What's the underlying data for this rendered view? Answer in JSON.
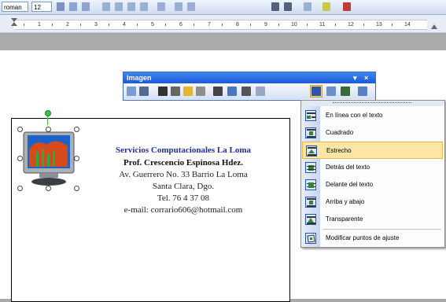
{
  "format_toolbar": {
    "font_name": "roman",
    "font_size": "12"
  },
  "ruler": {
    "numbers": [
      "1",
      "2",
      "3",
      "4",
      "5",
      "6",
      "7",
      "8",
      "9",
      "10",
      "11",
      "12",
      "13",
      "14"
    ]
  },
  "image_toolbar": {
    "title": "Imagen",
    "dropdown_glyph": "▾",
    "close_glyph": "×"
  },
  "wrap_menu": {
    "items": [
      {
        "label": "En línea con el texto",
        "highlighted": false
      },
      {
        "label": "Cuadrado",
        "highlighted": false
      },
      {
        "label": "Estrecho",
        "highlighted": true
      },
      {
        "label": "Detrás del texto",
        "highlighted": false
      },
      {
        "label": "Delante del texto",
        "highlighted": false
      },
      {
        "label": "Arriba y abajo",
        "highlighted": false
      },
      {
        "label": "Transparente",
        "highlighted": false
      },
      {
        "label": "Modificar puntos de ajuste",
        "highlighted": false
      }
    ]
  },
  "business_card": {
    "company": "Servicios Computacionales La Loma",
    "name": "Prof. Crescencio Espinosa Hdez.",
    "address": "Av. Guerrero No. 33 Barrio La Loma",
    "city": "Santa Clara, Dgo.",
    "phone": "Tel. 76 4 37 08",
    "email": "e-mail: corrario606@hotmail.com"
  },
  "colors": {
    "title_bar": "#1c59d6",
    "highlight": "#fbe6a8",
    "company_text": "#1f2fa0"
  }
}
